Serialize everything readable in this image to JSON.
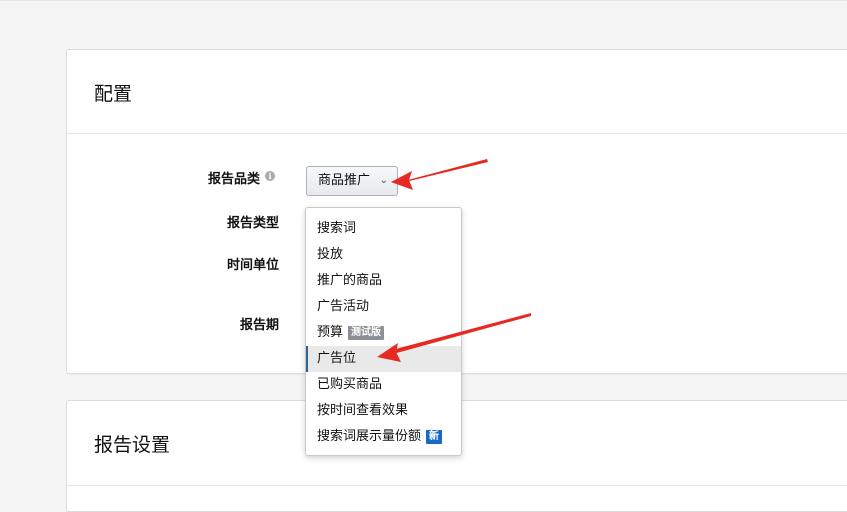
{
  "config_section": {
    "title": "配置",
    "fields": {
      "category_label": "报告品类",
      "type_label": "报告类型",
      "time_unit_label": "时间单位",
      "period_label": "报告期"
    },
    "info_icon_glyph": "i",
    "category_select": {
      "value": "商品推广",
      "chevron": "⌄"
    }
  },
  "report_type_dropdown": {
    "items": [
      {
        "label": "搜索词",
        "badge": ""
      },
      {
        "label": "投放",
        "badge": ""
      },
      {
        "label": "推广的商品",
        "badge": ""
      },
      {
        "label": "广告活动",
        "badge": ""
      },
      {
        "label": "预算",
        "badge": "测试版"
      },
      {
        "label": "广告位",
        "badge": ""
      },
      {
        "label": "已购买商品",
        "badge": ""
      },
      {
        "label": "按时间查看效果",
        "badge": ""
      },
      {
        "label": "搜索词展示量份额",
        "badge": "新"
      }
    ],
    "selected_index": 5
  },
  "report_settings_section": {
    "title": "报告设置"
  },
  "annotation_color": "#e62a23",
  "selected_accent_color": "#2a6496",
  "new_badge_color": "#1769c8"
}
